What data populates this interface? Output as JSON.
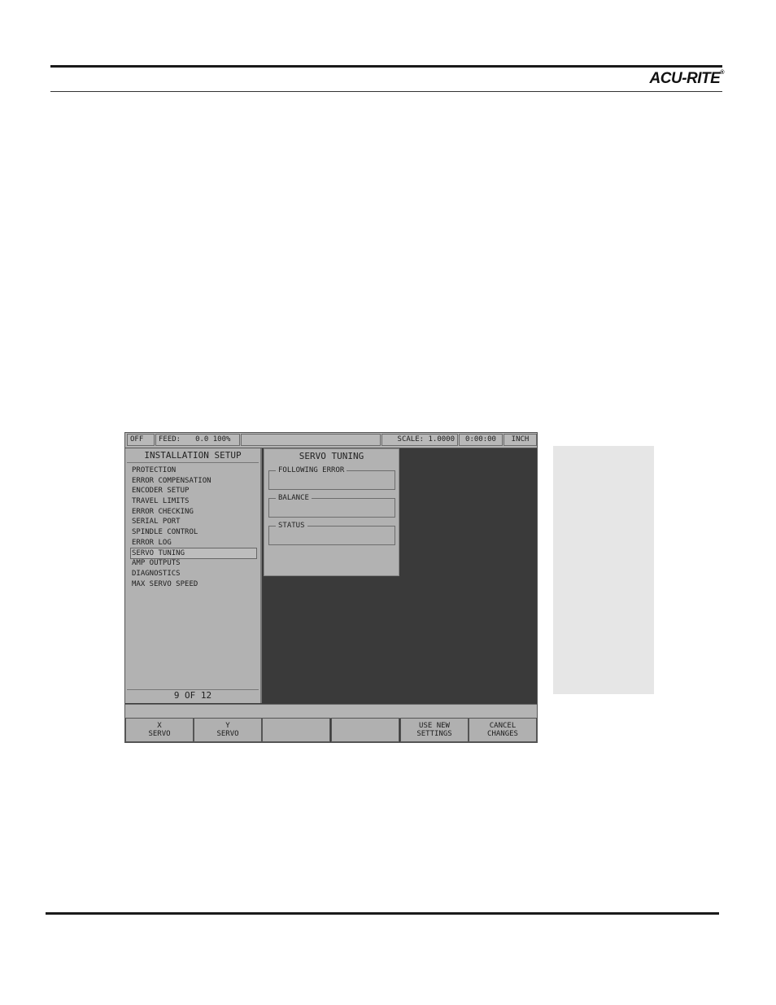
{
  "header": {
    "brand": "ACU-RITE",
    "trademark": "®"
  },
  "status_bar": {
    "mode": "OFF",
    "feed_label": "FEED:",
    "feed_value": "0.0 100%",
    "scale": "SCALE: 1.0000",
    "time": "0:00:00",
    "units": "INCH"
  },
  "menu": {
    "title": "INSTALLATION SETUP",
    "items": [
      "PROTECTION",
      "ERROR COMPENSATION",
      "ENCODER SETUP",
      "TRAVEL LIMITS",
      "ERROR CHECKING",
      "SERIAL PORT",
      "SPINDLE CONTROL",
      "ERROR LOG",
      "SERVO TUNING",
      "AMP OUTPUTS",
      "DIAGNOSTICS",
      "MAX SERVO SPEED"
    ],
    "selected_index": 8,
    "footer": "9 OF 12"
  },
  "servo_tuning": {
    "title": "SERVO TUNING",
    "groups": [
      "FOLLOWING ERROR",
      "BALANCE",
      "STATUS"
    ]
  },
  "softkeys": [
    {
      "line1": "X",
      "line2": "SERVO"
    },
    {
      "line1": "Y",
      "line2": "SERVO"
    },
    {
      "line1": "",
      "line2": ""
    },
    {
      "line1": "",
      "line2": ""
    },
    {
      "line1": "USE NEW",
      "line2": "SETTINGS"
    },
    {
      "line1": "CANCEL",
      "line2": "CHANGES"
    }
  ]
}
